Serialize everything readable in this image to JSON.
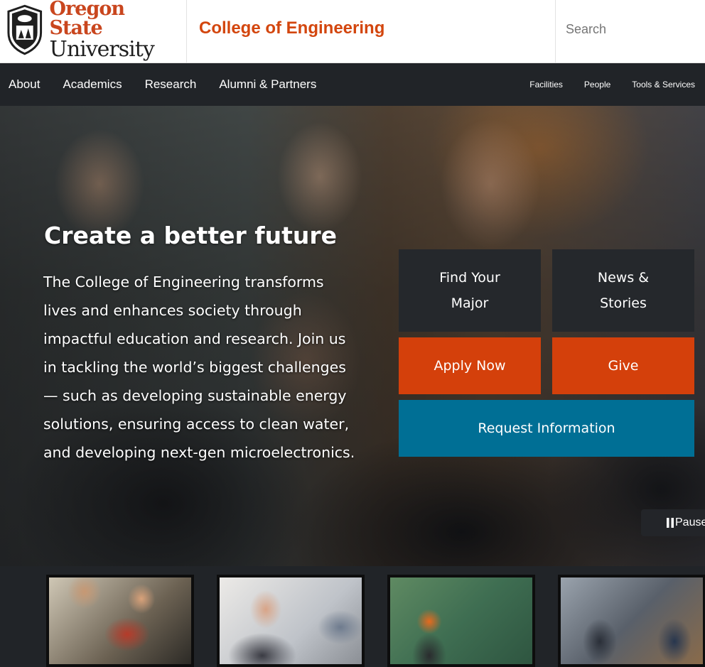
{
  "header": {
    "logo_line1": "Oregon State",
    "logo_line2": "University",
    "college": "College of Engineering",
    "search_placeholder": "Search"
  },
  "nav": {
    "primary": [
      "About",
      "Academics",
      "Research",
      "Alumni & Partners"
    ],
    "secondary": [
      "Facilities",
      "People",
      "Tools & Services"
    ]
  },
  "hero": {
    "title": "Create a better future",
    "body": "The College of Engineering transforms lives and enhances society through impactful education and research. Join us in tackling the world’s biggest challenges — such as developing sustainable energy solutions, ensuring access to clean water, and developing next-gen microelectronics.",
    "buttons": {
      "find_major": "Find Your Major",
      "news": "News & Stories",
      "apply": "Apply Now",
      "give": "Give",
      "request": "Request Information"
    },
    "pause_label": "Pause"
  },
  "colors": {
    "brand_orange": "#d4400b",
    "nav_dark": "#212428",
    "info_blue": "#006f95"
  }
}
